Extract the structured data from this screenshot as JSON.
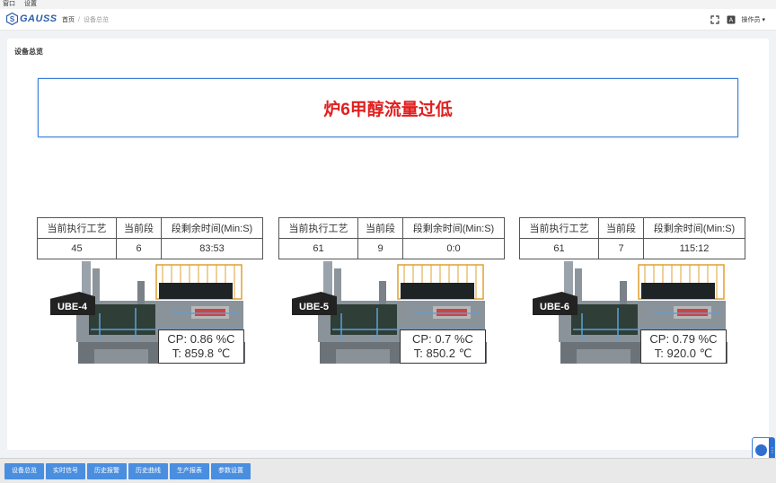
{
  "menubar": {
    "items": [
      "窗口",
      "设置"
    ]
  },
  "header": {
    "logo_text": "GAUSS",
    "breadcrumb": {
      "home": "首页",
      "separator": "/",
      "current": "设备总览"
    },
    "user_label": "操作员",
    "lang_badge": "A"
  },
  "panel": {
    "title": "设备总览"
  },
  "alarm": {
    "message": "炉6甲醇流量过低",
    "color": "#e02020"
  },
  "table_headers": {
    "process": "当前执行工艺",
    "segment": "当前段",
    "remaining": "段剩余时间(Min:S)"
  },
  "units": [
    {
      "name": "UBE-4",
      "process": "45",
      "segment": "6",
      "remaining": "83:53",
      "cp": "CP: 0.86 %C",
      "t": "T: 859.8 ℃"
    },
    {
      "name": "UBE-5",
      "process": "61",
      "segment": "9",
      "remaining": "0:0",
      "cp": "CP: 0.7 %C",
      "t": "T: 850.2 ℃"
    },
    {
      "name": "UBE-6",
      "process": "61",
      "segment": "7",
      "remaining": "115:12",
      "cp": "CP: 0.79 %C",
      "t": "T: 920.0 ℃"
    }
  ],
  "footer": {
    "buttons": [
      "设备总览",
      "实时信号",
      "历史报警",
      "历史曲线",
      "生产报表",
      "参数设置"
    ]
  },
  "colors": {
    "accent": "#4a8ee0",
    "alarm_border": "#3c7fd6"
  }
}
